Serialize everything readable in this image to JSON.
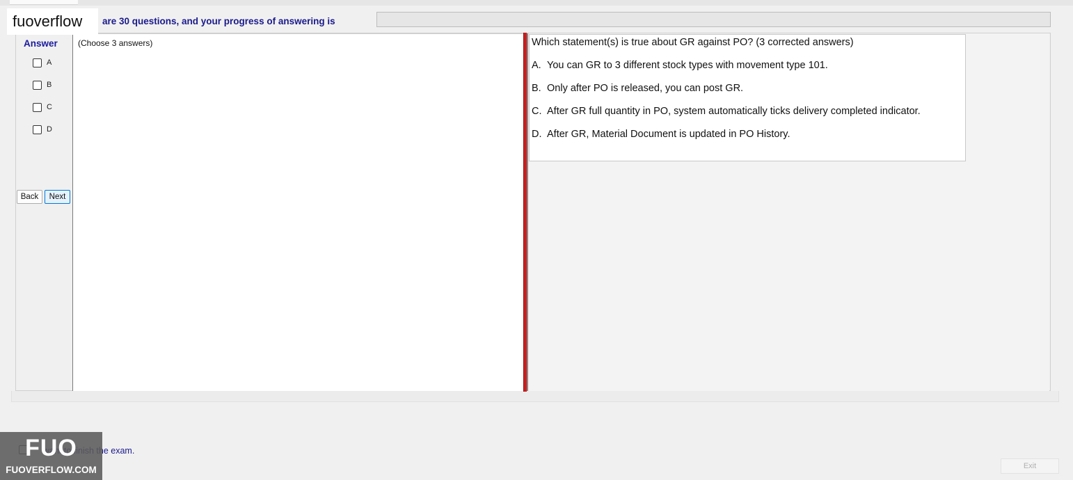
{
  "brand": {
    "text": "fuoverflow"
  },
  "header": {
    "progress_text": "are 30 questions, and your progress of answering is"
  },
  "answer_panel": {
    "title": "Answer",
    "options": [
      {
        "label": "A",
        "checked": false
      },
      {
        "label": "B",
        "checked": false
      },
      {
        "label": "C",
        "checked": false
      },
      {
        "label": "D",
        "checked": false
      }
    ],
    "back_label": "Back",
    "next_label": "Next"
  },
  "left_pane": {
    "instruction": "(Choose 3 answers)"
  },
  "question": {
    "text": "Which statement(s) is true about GR against PO? (3 corrected answers)",
    "choices": [
      {
        "letter": "A.",
        "text": "You can GR to 3 different stock types with movement type 101."
      },
      {
        "letter": "B.",
        "text": "Only after PO is released, you can post GR."
      },
      {
        "letter": "C.",
        "text": "After GR full quantity in PO, system automatically ticks delivery completed indicator."
      },
      {
        "letter": "D.",
        "text": "After GR, Material Document is updated in PO History."
      }
    ]
  },
  "footer": {
    "finish_text": "want to finish the exam.",
    "exit_label": "Exit"
  },
  "logo": {
    "mark": "FUO",
    "site": "FUOVERFLOW.COM"
  },
  "colors": {
    "accent_text": "#1a1a8c",
    "splitter": "#cc1f1f",
    "next_button_border": "#0078d7"
  }
}
